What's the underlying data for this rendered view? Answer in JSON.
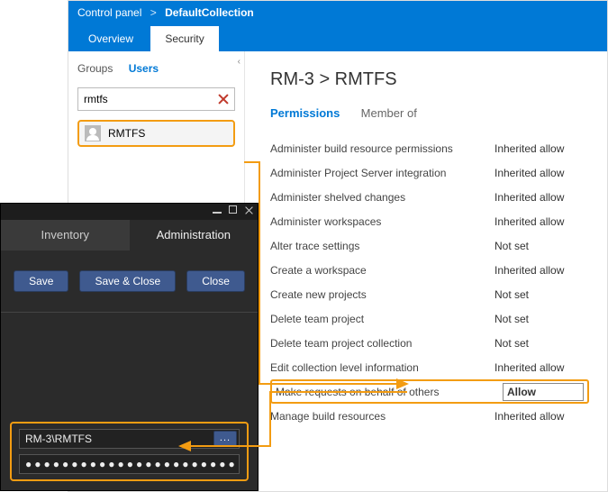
{
  "breadcrumb": {
    "root": "Control panel",
    "separator": ">",
    "current": "DefaultCollection"
  },
  "header_tabs": {
    "overview": "Overview",
    "security": "Security"
  },
  "left": {
    "groups_label": "Groups",
    "users_label": "Users",
    "search_value": "rmtfs",
    "selected_user": "RMTFS"
  },
  "right": {
    "title": "RM-3 > RMTFS",
    "tab_permissions": "Permissions",
    "tab_memberof": "Member of",
    "permissions": [
      {
        "name": "Administer build resource permissions",
        "value": "Inherited allow"
      },
      {
        "name": "Administer Project Server integration",
        "value": "Inherited allow"
      },
      {
        "name": "Administer shelved changes",
        "value": "Inherited allow"
      },
      {
        "name": "Administer workspaces",
        "value": "Inherited allow"
      },
      {
        "name": "Alter trace settings",
        "value": "Not set"
      },
      {
        "name": "Create a workspace",
        "value": "Inherited allow"
      },
      {
        "name": "Create new projects",
        "value": "Not set"
      },
      {
        "name": "Delete team project",
        "value": "Not set"
      },
      {
        "name": "Delete team project collection",
        "value": "Not set"
      },
      {
        "name": "Edit collection level information",
        "value": "Inherited allow"
      },
      {
        "name": "Make requests on behalf of others",
        "value": "Allow"
      },
      {
        "name": "Manage build resources",
        "value": "Inherited allow"
      }
    ]
  },
  "dialog": {
    "tab_inventory": "Inventory",
    "tab_admin": "Administration",
    "btn_save": "Save",
    "btn_save_close": "Save & Close",
    "btn_close": "Close",
    "cred_user": "RM-3\\RMTFS",
    "browse_label": "...",
    "cred_pass_mask": "●●●●●●●●●●●●●●●●●●●●●●●"
  }
}
